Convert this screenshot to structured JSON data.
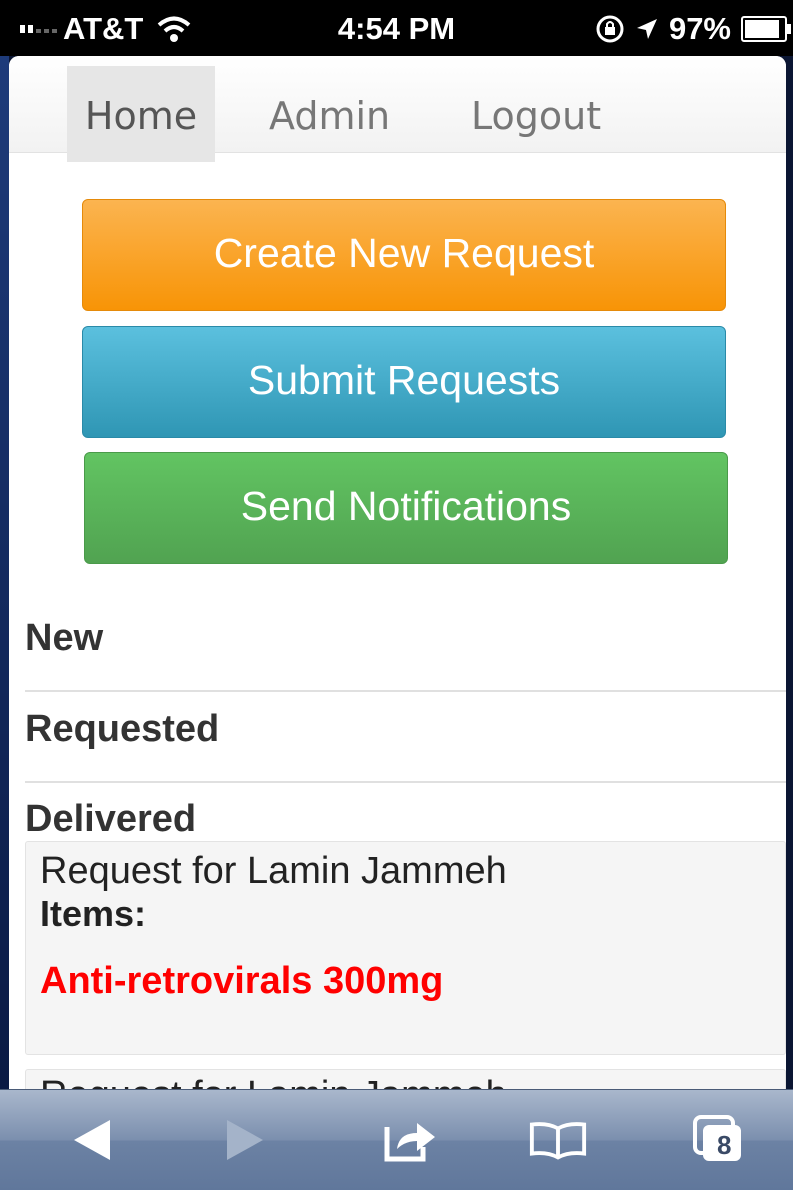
{
  "status_bar": {
    "carrier": "AT&T",
    "time": "4:54 PM",
    "battery": "97%"
  },
  "nav": {
    "items": [
      {
        "label": "Home",
        "active": true
      },
      {
        "label": "Admin",
        "active": false
      },
      {
        "label": "Logout",
        "active": false
      }
    ]
  },
  "actions": {
    "create": "Create New Request",
    "submit": "Submit Requests",
    "notify": "Send Notifications"
  },
  "sections": {
    "new": "New",
    "requested": "Requested",
    "delivered": "Delivered"
  },
  "requests": [
    {
      "title": "Request for Lamin Jammeh",
      "items_label": "Items:",
      "items": [
        "Anti-retrovirals 300mg"
      ]
    },
    {
      "title": "Request for Lamin Jammeh"
    }
  ],
  "toolbar": {
    "tab_count": "8",
    "icons": [
      "back-arrow-icon",
      "forward-arrow-icon",
      "share-icon",
      "bookmarks-icon",
      "tabs-icon"
    ]
  },
  "colors": {
    "orange": "#f89406",
    "blue": "#2f96b4",
    "green": "#51a351",
    "item_red": "#ff0000"
  }
}
